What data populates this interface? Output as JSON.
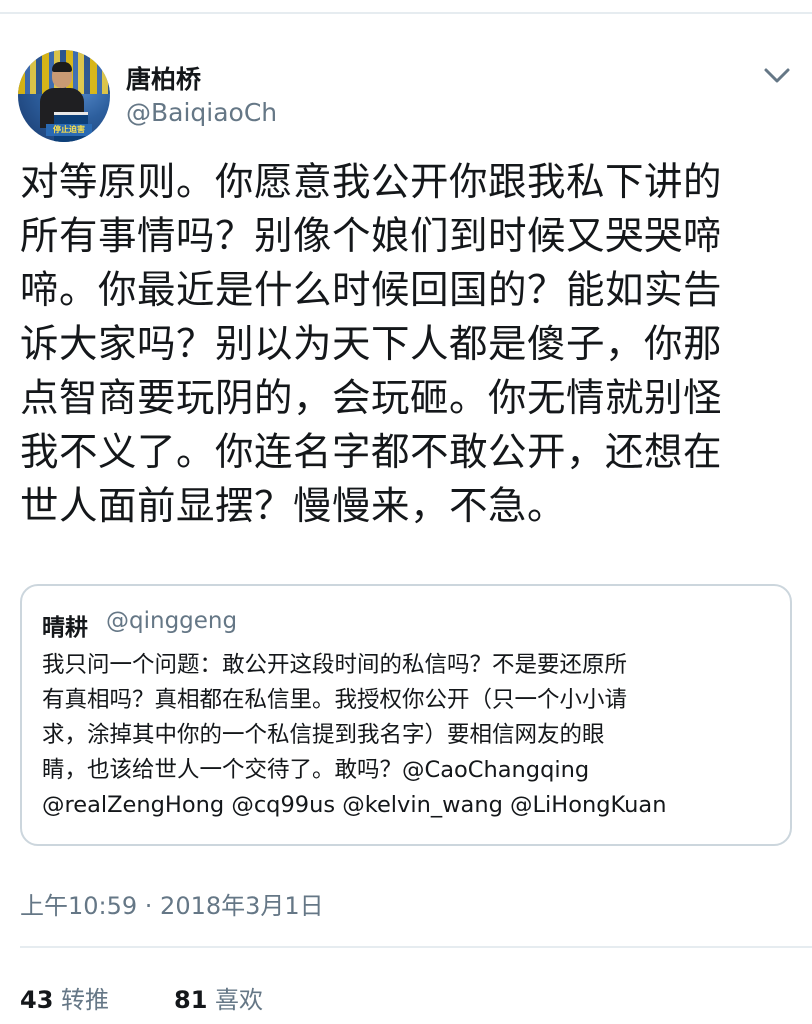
{
  "tweet": {
    "author": {
      "display_name": "唐柏桥",
      "handle": "@BaiqiaoCh",
      "avatar_banner_text": "停止迫害"
    },
    "text": "对等原则。你愿意我公开你跟我私下讲的\n所有事情吗？别像个娘们到时候又哭哭啼\n啼。你最近是什么时候回国的？能如实告\n诉大家吗？别以为天下人都是傻子，你那\n点智商要玩阴的，会玩砸。你无情就别怪\n我不义了。你连名字都不敢公开，还想在\n世人面前显摆？慢慢来，不急。",
    "quoted": {
      "display_name": "晴耕",
      "handle": "@qinggeng",
      "text": "我只问一个问题：敢公开这段时间的私信吗？不是要还原所\n有真相吗？真相都在私信里。我授权你公开（只一个小小请\n求，涂掉其中你的一个私信提到我名字）要相信网友的眼\n睛，也该给世人一个交待了。敢吗？@CaoChangqing\n@realZengHong @cq99us @kelvin_wang @LiHongKuan"
    },
    "timestamp": "上午10:59 · 2018年3月1日",
    "stats": {
      "retweets": {
        "count": "43",
        "label": "转推"
      },
      "likes": {
        "count": "81",
        "label": "喜欢"
      }
    },
    "menu_icon": "chevron-down-icon"
  },
  "colors": {
    "text_primary": "#14171a",
    "text_secondary": "#657786",
    "border": "#ccd6dd",
    "divider": "#e6ecf0"
  }
}
